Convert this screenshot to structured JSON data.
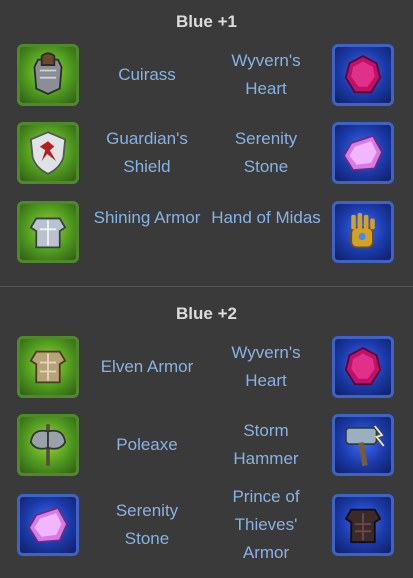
{
  "sections": [
    {
      "title": "Blue +1",
      "rows": [
        {
          "left": {
            "name": "Cuirass",
            "icon": "cuirass-icon",
            "frame": "green"
          },
          "right": {
            "name": "Wyvern's Heart",
            "icon": "wyverns-heart-icon",
            "frame": "blue"
          }
        },
        {
          "left": {
            "name": "Guardian's Shield",
            "icon": "guardians-shield-icon",
            "frame": "green"
          },
          "right": {
            "name": "Serenity Stone",
            "icon": "serenity-stone-icon",
            "frame": "blue"
          }
        },
        {
          "left": {
            "name": "Shining Armor",
            "icon": "shining-armor-icon",
            "frame": "green"
          },
          "right": {
            "name": "Hand of Midas",
            "icon": "hand-of-midas-icon",
            "frame": "blue"
          }
        }
      ]
    },
    {
      "title": "Blue +2",
      "rows": [
        {
          "left": {
            "name": "Elven Armor",
            "icon": "elven-armor-icon",
            "frame": "green"
          },
          "right": {
            "name": "Wyvern's Heart",
            "icon": "wyverns-heart-icon",
            "frame": "blue"
          }
        },
        {
          "left": {
            "name": "Poleaxe",
            "icon": "poleaxe-icon",
            "frame": "green"
          },
          "right": {
            "name": "Storm Hammer",
            "icon": "storm-hammer-icon",
            "frame": "blue"
          }
        },
        {
          "left": {
            "name": "Serenity Stone",
            "icon": "serenity-stone-icon",
            "frame": "blue"
          },
          "right": {
            "name": "Prince of Thieves' Armor",
            "icon": "prince-of-thieves-armor-icon",
            "frame": "blue"
          }
        }
      ]
    }
  ],
  "colors": {
    "background": "#3a3a3a",
    "title": "#dcdcdc",
    "item_text": "#86b3e6",
    "green_frame": "#4e8a2a",
    "blue_frame": "#3e63c4"
  }
}
